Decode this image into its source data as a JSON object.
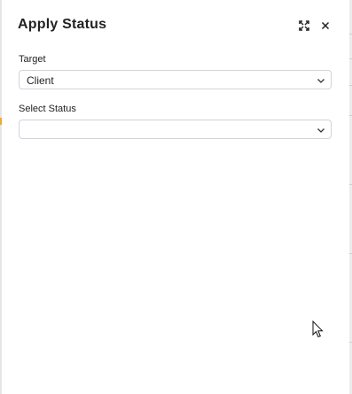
{
  "dialog": {
    "title": "Apply Status",
    "expand_icon": "expand-icon",
    "close_icon": "close-icon"
  },
  "target": {
    "label": "Target",
    "value": "Client",
    "chevron_icon": "chevron-down-icon"
  },
  "status": {
    "label": "Select Status",
    "value": "",
    "chevron_icon": "chevron-down-icon"
  },
  "colors": {
    "border": "#cfd4da",
    "text": "#222222",
    "backdrop_accent": "#f0a830"
  }
}
